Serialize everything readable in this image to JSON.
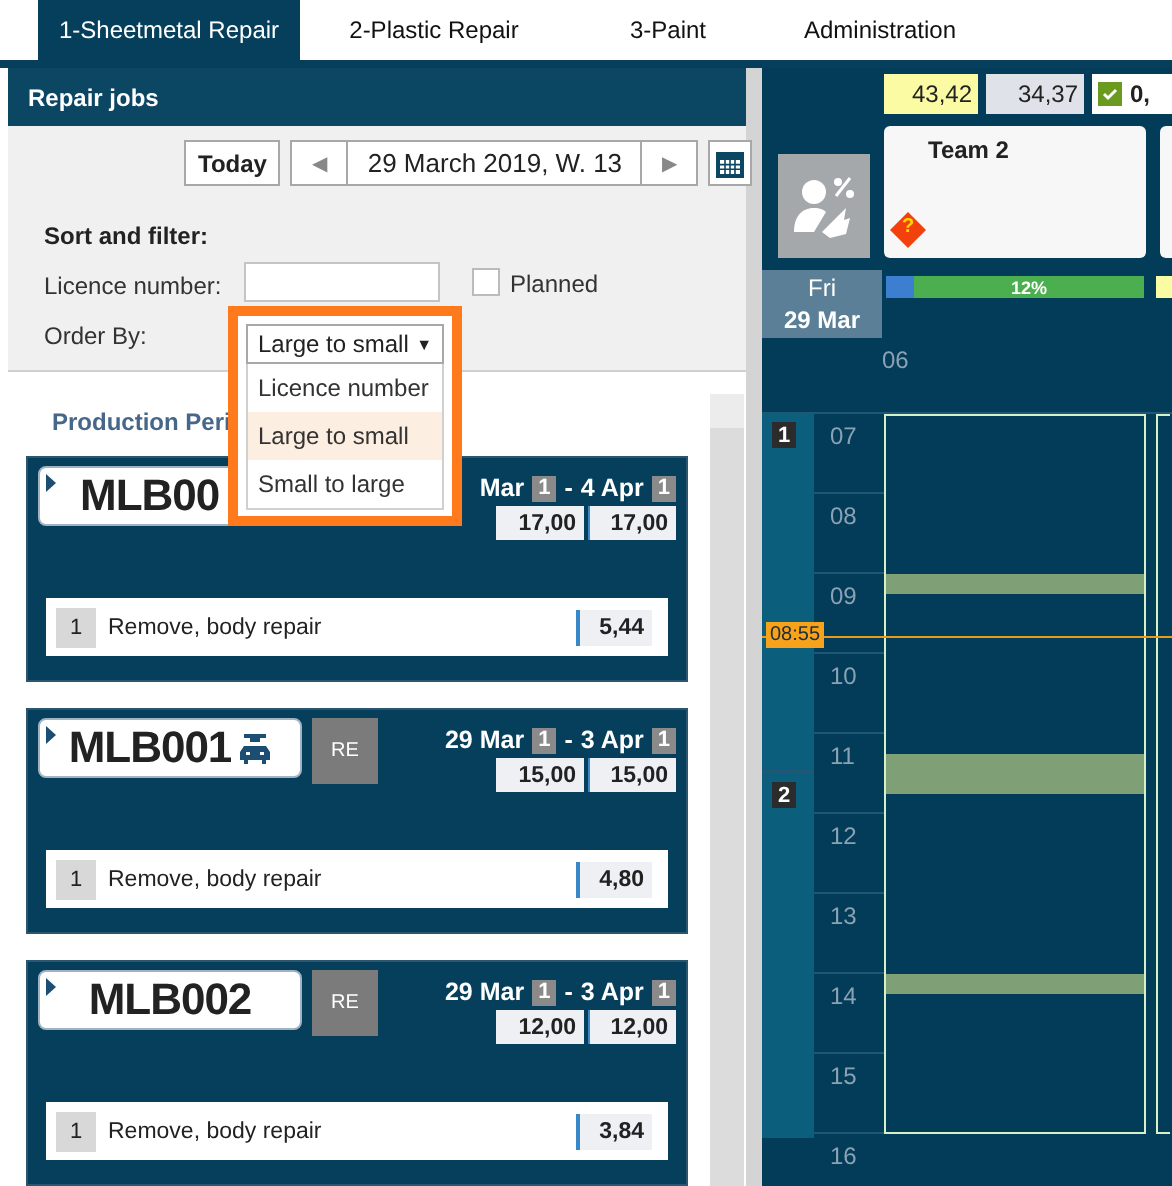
{
  "tabs": [
    {
      "label": "1-Sheetmetal Repair",
      "selected": true
    },
    {
      "label": "2-Plastic Repair",
      "selected": false
    },
    {
      "label": "3-Paint",
      "selected": false
    },
    {
      "label": "Administration",
      "selected": false
    }
  ],
  "repair_jobs": {
    "title": "Repair jobs",
    "today_button": "Today",
    "prev": "◀",
    "date": "29 March 2019, W. 13",
    "next": "▶",
    "sort_heading": "Sort and filter:",
    "licence_label": "Licence number:",
    "planned": {
      "label": "Planned",
      "checked": false
    },
    "order_label": "Order By:",
    "order_dropdown": {
      "value": "Large to small",
      "caret": "▼",
      "expanded": true,
      "options": [
        {
          "label": "Licence number",
          "selected": false
        },
        {
          "label": "Large to small",
          "selected": true
        },
        {
          "label": "Small to large",
          "selected": false
        }
      ]
    },
    "section_heading": "Production Peri",
    "jobs": [
      {
        "plate": "MLB00",
        "car": false,
        "dates": [
          {
            "text": "Mar",
            "week": "1"
          },
          {
            "text": "4 Apr",
            "week": "1"
          }
        ],
        "separator": "-",
        "hours": [
          "17,00",
          "17,00"
        ],
        "tasks": [
          {
            "number": "1",
            "name": "Remove, body repair",
            "value": "5,44"
          }
        ]
      },
      {
        "plate": "MLB001",
        "car": true,
        "badge": "RE",
        "dates": [
          {
            "text": "29 Mar",
            "week": "1"
          },
          {
            "text": "3 Apr",
            "week": "1"
          }
        ],
        "separator": "-",
        "hours": [
          "15,00",
          "15,00"
        ],
        "tasks": [
          {
            "number": "1",
            "name": "Remove, body repair",
            "value": "4,80"
          }
        ]
      },
      {
        "plate": "MLB002",
        "car": false,
        "badge": "RE",
        "dates": [
          {
            "text": "29 Mar",
            "week": "1"
          },
          {
            "text": "3 Apr",
            "week": "1"
          }
        ],
        "separator": "-",
        "hours": [
          "12,00",
          "12,00"
        ],
        "tasks": [
          {
            "number": "1",
            "name": "Remove, body repair",
            "value": "3,84"
          }
        ]
      }
    ]
  },
  "planner": {
    "totals": [
      {
        "kind": "target",
        "value": "43,42"
      },
      {
        "kind": "actual",
        "value": "34,37"
      },
      {
        "kind": "checked",
        "value": "0,"
      }
    ],
    "team": {
      "name": "Team 2",
      "warning": "?"
    },
    "day": {
      "weekday": "Fri",
      "date": "29 Mar"
    },
    "progress_label": "12%",
    "now": "08:55",
    "shifts": [
      {
        "number": "1"
      },
      {
        "number": "2"
      }
    ],
    "hours": [
      "06",
      "07",
      "08",
      "09",
      "10",
      "11",
      "12",
      "13",
      "14",
      "15",
      "16"
    ]
  }
}
